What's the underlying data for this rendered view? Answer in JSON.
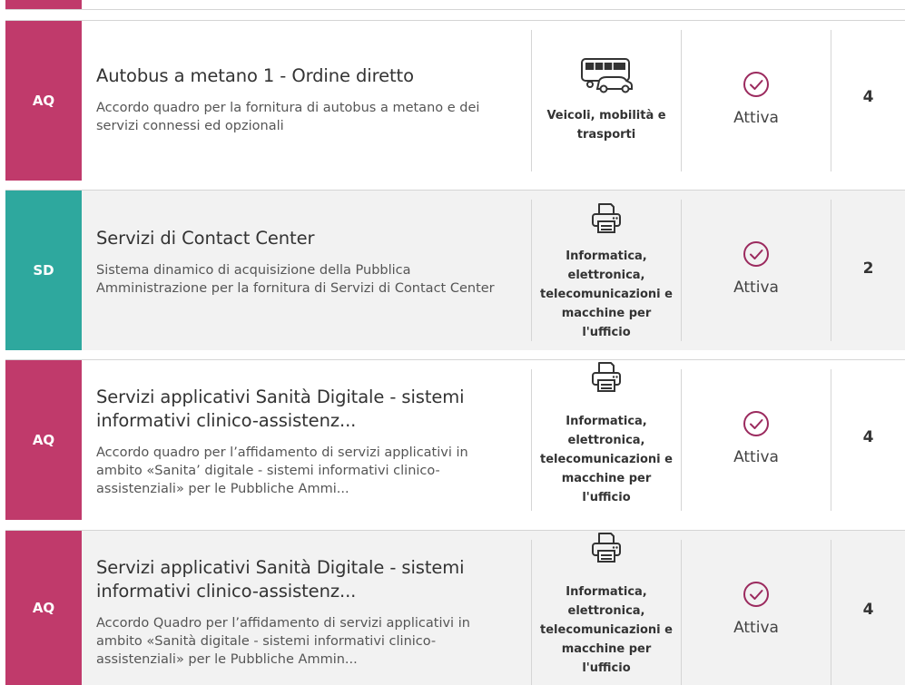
{
  "colors": {
    "aq_badge": "#c03a6b",
    "sd_badge": "#2ea89e",
    "status_icon": "#9b2a5e",
    "row_alt_bg": "#f2f2f2"
  },
  "rows": [
    {
      "badge": "AQ",
      "title": "Autobus a metano 1 - Ordine diretto",
      "title_line2": "",
      "description": "Accordo quadro per la fornitura di autobus a metano e dei servizi connessi ed opzionali",
      "category_icon": "bus-car-icon",
      "category": "Veicoli, mobilità e trasporti",
      "status": "Attiva",
      "status_icon": "check-circle-icon",
      "count": "4"
    },
    {
      "badge": "SD",
      "title": "Servizi di Contact Center",
      "title_line2": "",
      "description": "Sistema dinamico di acquisizione della Pubblica Amministrazione per la fornitura di Servizi di Contact Center",
      "category_icon": "printer-icon",
      "category": "Informatica, elettronica, telecomunicazioni e macchine per l'ufficio",
      "status": "Attiva",
      "status_icon": "check-circle-icon",
      "count": "2"
    },
    {
      "badge": "AQ",
      "title": "Servizi applicativi Sanità Digitale - sistemi",
      "title_line2": "informativi clinico-assistenz...",
      "description": "Accordo quadro per l’affidamento di servizi applicativi in ambito «Sanita’ digitale - sistemi informativi clinico-assistenziali» per le Pubbliche Ammi...",
      "category_icon": "printer-icon",
      "category": "Informatica, elettronica, telecomunicazioni e macchine per l'ufficio",
      "status": "Attiva",
      "status_icon": "check-circle-icon",
      "count": "4"
    },
    {
      "badge": "AQ",
      "title": "Servizi applicativi Sanità Digitale - sistemi",
      "title_line2": "informativi clinico-assistenz...",
      "description": "Accordo Quadro per l’affidamento di servizi applicativi in ambito «Sanità digitale - sistemi informativi clinico-assistenziali» per le Pubbliche Ammin...",
      "category_icon": "printer-icon",
      "category": "Informatica, elettronica, telecomunicazioni e macchine per l'ufficio",
      "status": "Attiva",
      "status_icon": "check-circle-icon",
      "count": "4"
    }
  ]
}
